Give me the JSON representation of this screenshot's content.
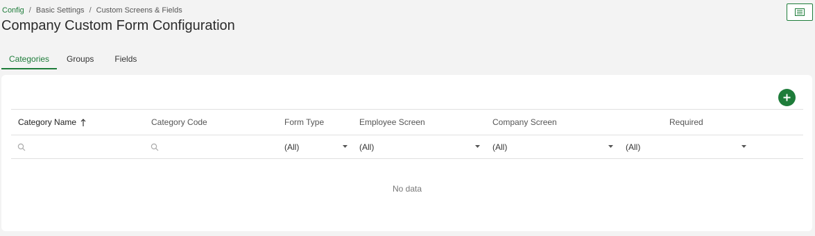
{
  "breadcrumb": {
    "items": [
      "Config",
      "Basic Settings",
      "Custom Screens & Fields"
    ],
    "separator": "/"
  },
  "page": {
    "title": "Company Custom Form Configuration"
  },
  "tabs": [
    {
      "label": "Categories",
      "active": true
    },
    {
      "label": "Groups",
      "active": false
    },
    {
      "label": "Fields",
      "active": false
    }
  ],
  "grid": {
    "columns": [
      {
        "label": "Category Name",
        "sorted": "ascending"
      },
      {
        "label": "Category Code"
      },
      {
        "label": "Form Type"
      },
      {
        "label": "Employee Screen"
      },
      {
        "label": "Company Screen"
      },
      {
        "label": "Required"
      }
    ],
    "filters": {
      "form_type": "(All)",
      "employee_screen": "(All)",
      "company_screen": "(All)",
      "required": "(All)"
    },
    "empty_text": "No data"
  },
  "icons": {
    "view_toggle": "list-view-icon",
    "add": "plus-icon",
    "search": "search-icon",
    "sort": "arrow-up-icon",
    "dropdown": "caret-down-icon"
  },
  "colors": {
    "accent": "#1e7c3a",
    "background": "#f3f3f3",
    "panel": "#ffffff"
  }
}
